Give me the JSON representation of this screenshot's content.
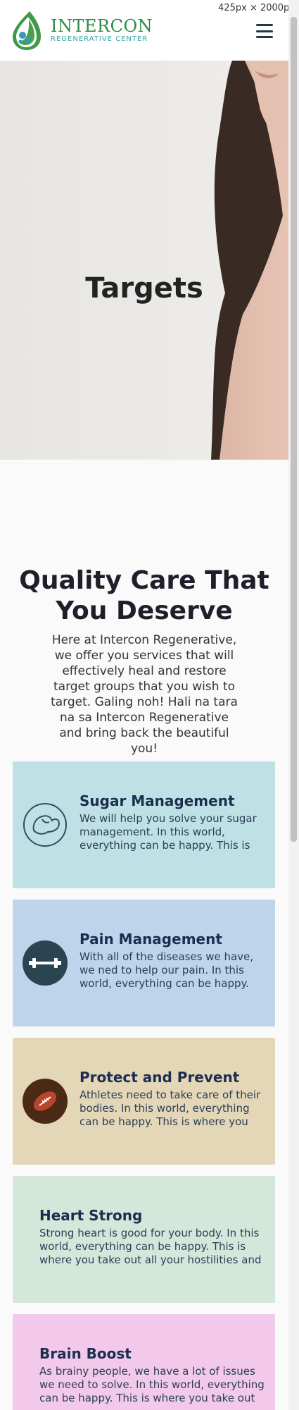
{
  "header": {
    "logo_title": "INTERCON",
    "logo_subtitle": "REGENERATIVE CENTER",
    "menu_icon": "hamburger-menu-icon"
  },
  "overlay": {
    "dimensions_label": "425px × 2000px"
  },
  "hero": {
    "title": "Targets"
  },
  "intro": {
    "heading": "Quality Care That You Deserve",
    "text": "Here at Intercon Regenerative, we offer you services that will effectively heal and restore target groups that you wish to target. Galing noh! Hali na tara na sa Intercon Regenerative and bring back the beautiful you!"
  },
  "cards": [
    {
      "title": "Sugar Management",
      "description": "We will help you solve your sugar management. In this world, everything can be happy. This is where you take out all your hostilities and frustrations.",
      "icon": "strength-arm-icon",
      "color": "#bfe1e6"
    },
    {
      "title": "Pain Management",
      "description": "With all of the diseases we have, we ned to help our pain. In this world, everything can be happy. This is where you take out all your hostilities.",
      "icon": "dumbbell-icon",
      "color": "#bdd4ea"
    },
    {
      "title": "Protect and Prevent",
      "description": "Athletes need to take care of their bodies. In this world, everything can be happy. This is where you take out all your hostilities.",
      "icon": "football-icon",
      "color": "#e4d7b8"
    },
    {
      "title": "Heart Strong",
      "description": "Strong heart is good for your body. In this world, everything can be happy. This is where you take out all your hostilities and frustrations.",
      "color": "#d3e8da"
    },
    {
      "title": "Brain Boost",
      "description": "As brainy people, we have a lot of issues we need to solve. In this world, everything can be happy. This is where you take out all your hostilities.",
      "color": "#f2c9ea"
    }
  ]
}
